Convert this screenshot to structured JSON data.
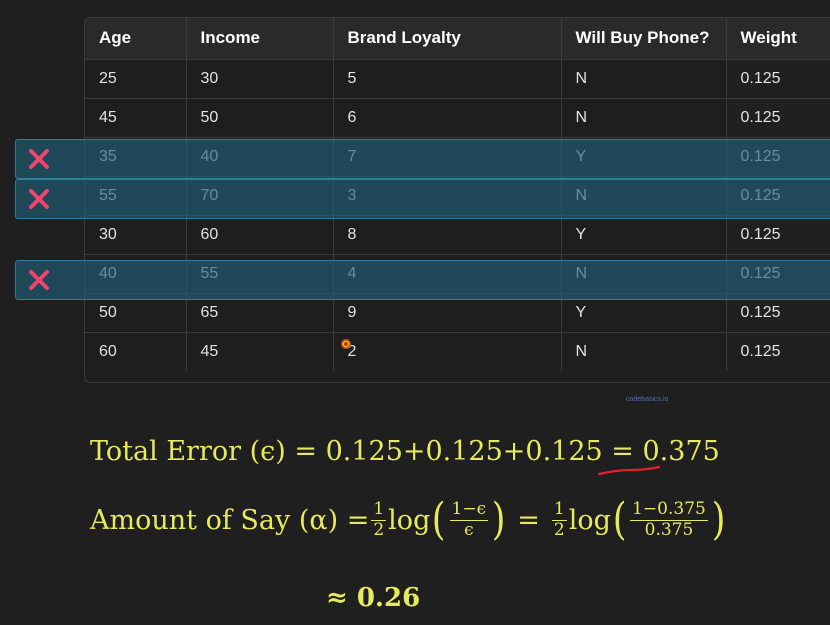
{
  "table": {
    "headers": [
      "Age",
      "Income",
      "Brand Loyalty",
      "Will Buy Phone?",
      "Weight"
    ],
    "rows": [
      {
        "cells": [
          "25",
          "30",
          "5",
          "N",
          "0.125"
        ],
        "misclassified": false
      },
      {
        "cells": [
          "45",
          "50",
          "6",
          "N",
          "0.125"
        ],
        "misclassified": false
      },
      {
        "cells": [
          "35",
          "40",
          "7",
          "Y",
          "0.125"
        ],
        "misclassified": true
      },
      {
        "cells": [
          "55",
          "70",
          "3",
          "N",
          "0.125"
        ],
        "misclassified": true
      },
      {
        "cells": [
          "30",
          "60",
          "8",
          "Y",
          "0.125"
        ],
        "misclassified": false
      },
      {
        "cells": [
          "40",
          "55",
          "4",
          "N",
          "0.125"
        ],
        "misclassified": true
      },
      {
        "cells": [
          "50",
          "65",
          "9",
          "Y",
          "0.125"
        ],
        "misclassified": false
      },
      {
        "cells": [
          "60",
          "45",
          "2",
          "N",
          "0.125"
        ],
        "misclassified": false
      }
    ]
  },
  "watermark": "codebasics.io",
  "formulas": {
    "total_error": {
      "lhs": "Total Error (ϵ) = ",
      "sum": "0.125+0.125+0.125 = ",
      "answer": "0.375"
    },
    "amount_of_say": {
      "lhs": "Amount of Say (α) = ",
      "half_num": "1",
      "half_den": "2",
      "log": "log",
      "frac1_num": "1−ϵ",
      "frac1_den": "ϵ",
      "equals": "=",
      "frac2_num": "1−0.375",
      "frac2_den": "0.375"
    },
    "approx": "≈ 0.26"
  },
  "colors": {
    "highlight": "#206078",
    "x_mark": "#f2456d",
    "formula": "#e7ea5e",
    "underline": "#e0202a"
  }
}
